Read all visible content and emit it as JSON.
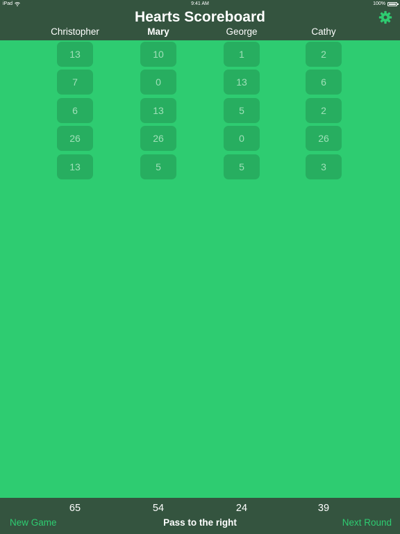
{
  "status_bar": {
    "device": "iPad",
    "time": "9:41 AM",
    "battery": "100%"
  },
  "header": {
    "title": "Hearts Scoreboard",
    "settings_icon": "gear-icon"
  },
  "players": [
    {
      "name": "Christopher",
      "dealer": false
    },
    {
      "name": "Mary",
      "dealer": true
    },
    {
      "name": "George",
      "dealer": false
    },
    {
      "name": "Cathy",
      "dealer": false
    }
  ],
  "rounds": [
    [
      "13",
      "10",
      "1",
      "2"
    ],
    [
      "7",
      "0",
      "13",
      "6"
    ],
    [
      "6",
      "13",
      "5",
      "2"
    ],
    [
      "26",
      "26",
      "0",
      "26"
    ],
    [
      "13",
      "5",
      "5",
      "3"
    ]
  ],
  "footer": {
    "totals": [
      "65",
      "54",
      "24",
      "39"
    ],
    "new_game_label": "New Game",
    "pass_label": "Pass to the right",
    "next_round_label": "Next Round"
  },
  "colors": {
    "background": "#2ecc71",
    "bar": "#34543f",
    "cell": "#27ae60",
    "accent": "#2ecc71"
  }
}
